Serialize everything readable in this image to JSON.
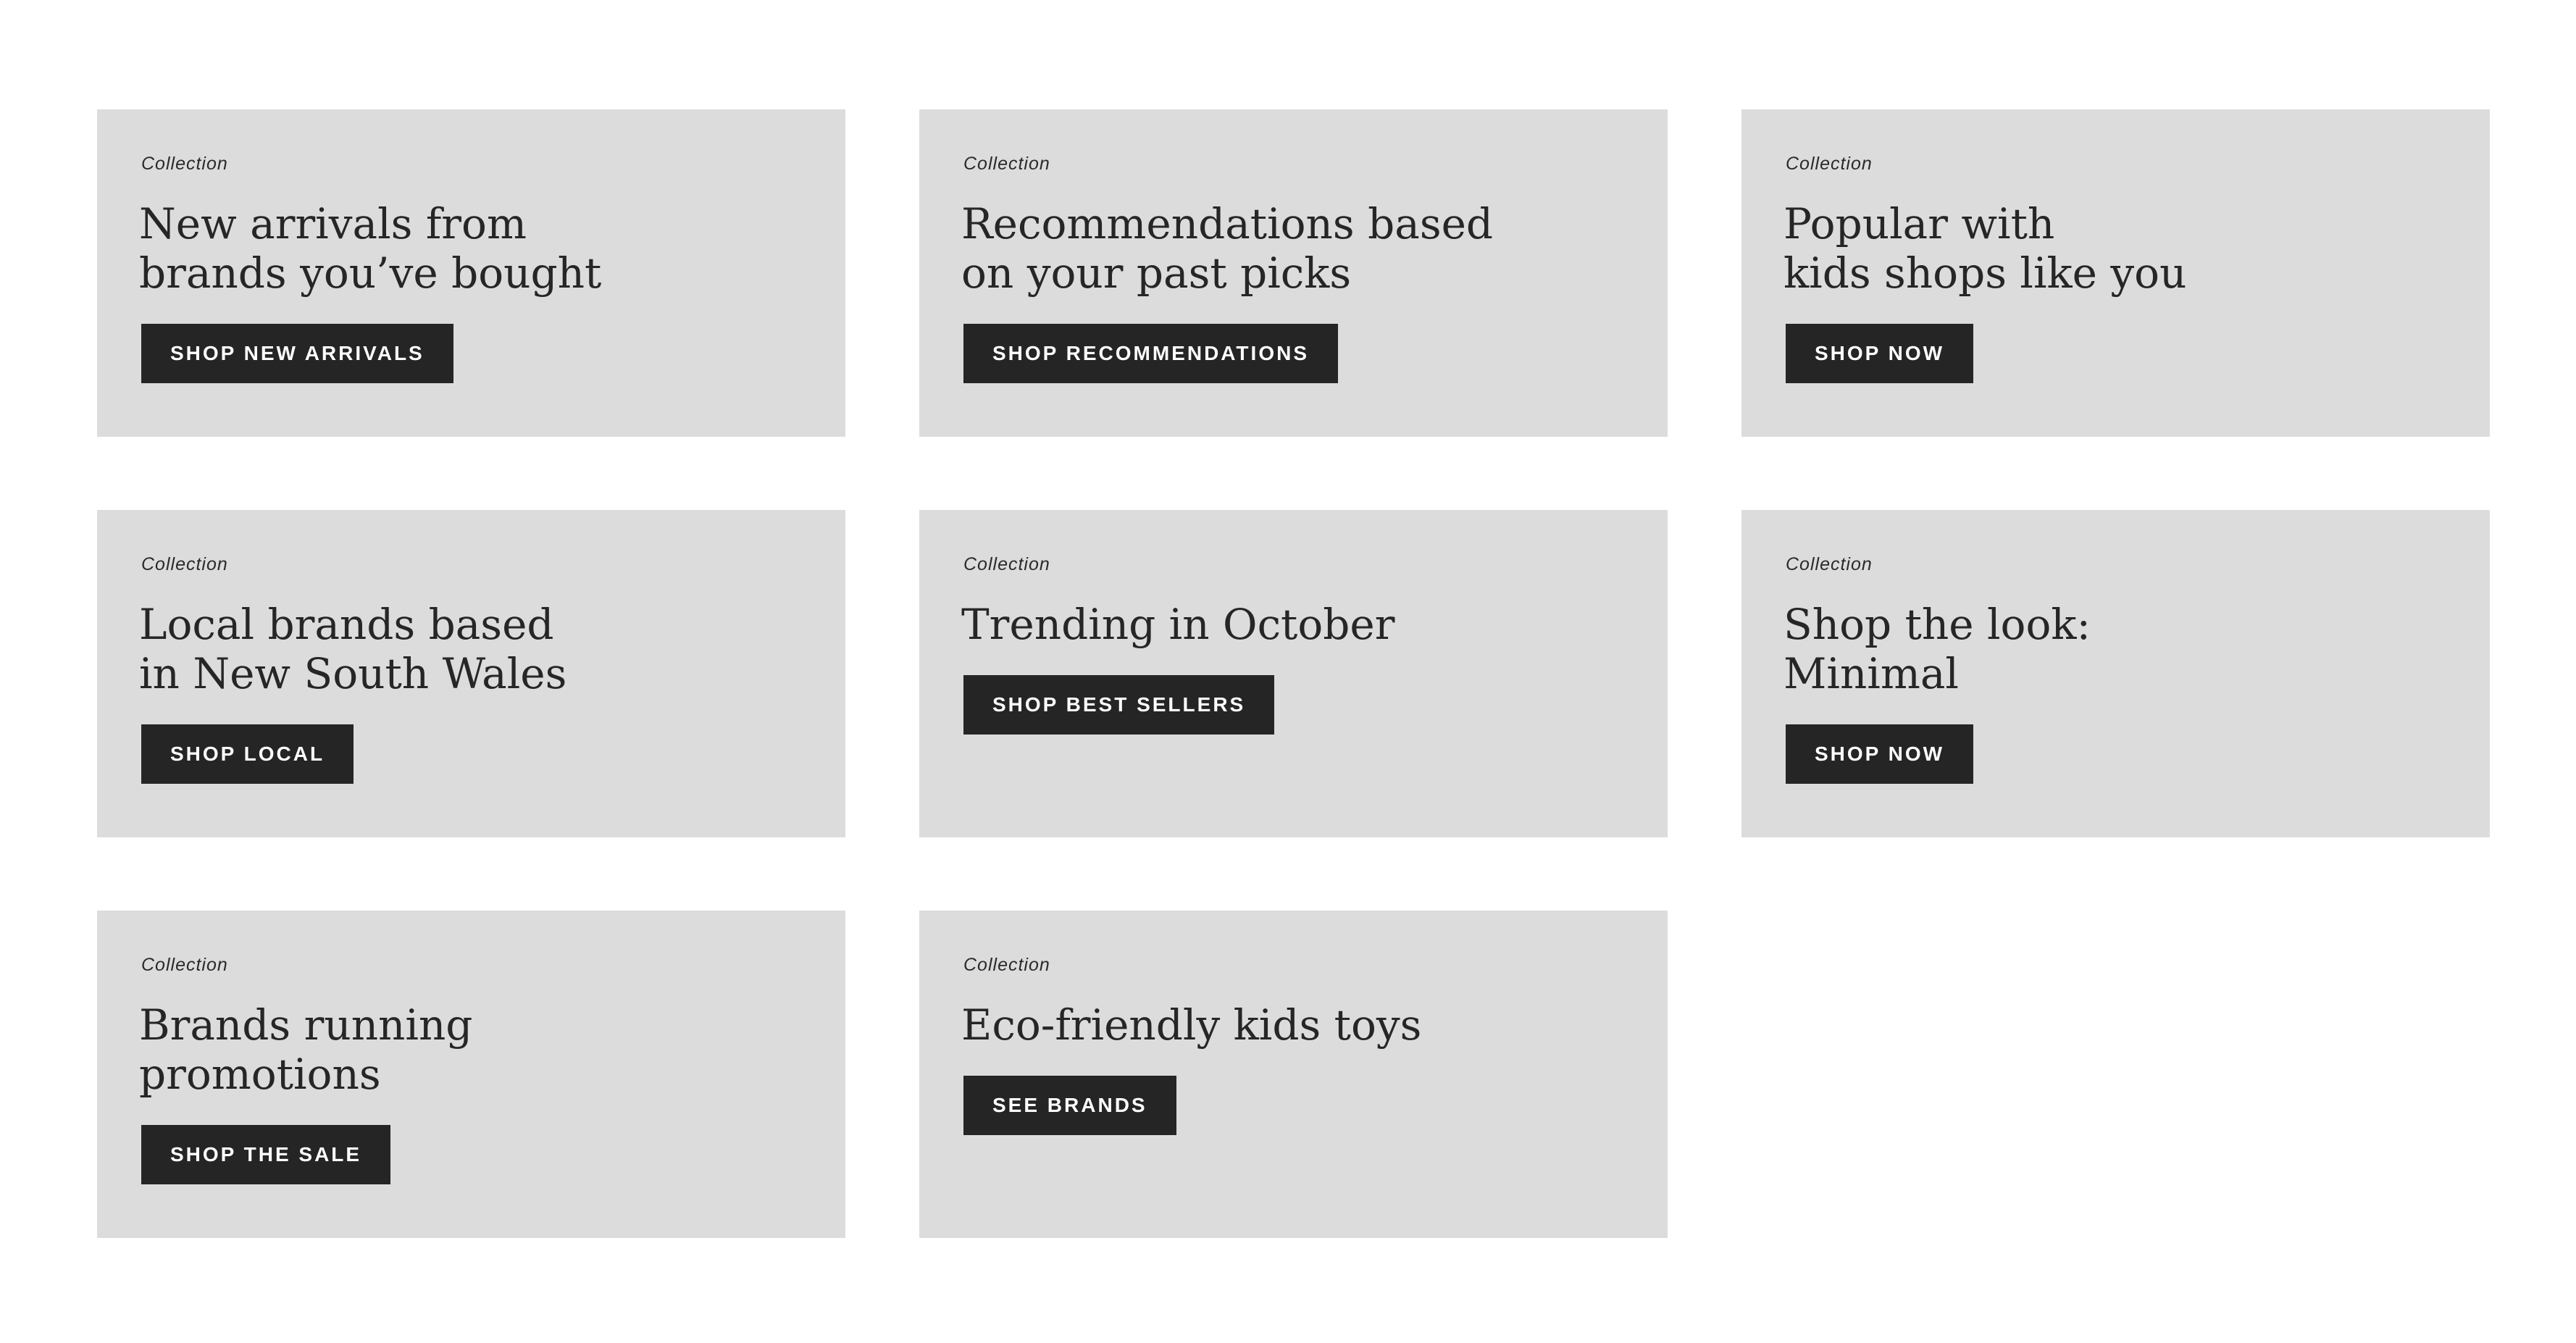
{
  "cards": [
    {
      "eyebrow": "Collection",
      "title": "New arrivals from\nbrands you’ve bought",
      "button": "SHOP NEW ARRIVALS"
    },
    {
      "eyebrow": "Collection",
      "title": "Recommendations based\non your past picks",
      "button": "SHOP RECOMMENDATIONS"
    },
    {
      "eyebrow": "Collection",
      "title": "Popular with\nkids shops like you",
      "button": "SHOP NOW"
    },
    {
      "eyebrow": "Collection",
      "title": "Local brands based\nin New South Wales",
      "button": "SHOP LOCAL"
    },
    {
      "eyebrow": "Collection",
      "title": "Trending in October",
      "button": "SHOP BEST SELLERS"
    },
    {
      "eyebrow": "Collection",
      "title": "Shop the look:\nMinimal",
      "button": "SHOP NOW"
    },
    {
      "eyebrow": "Collection",
      "title": "Brands running\npromotions",
      "button": "SHOP THE SALE"
    },
    {
      "eyebrow": "Collection",
      "title": "Eco-friendly kids toys",
      "button": "SEE BRANDS"
    }
  ],
  "colors": {
    "page_background": "#ffffff",
    "card_background": "#dcdcdc",
    "button_background": "#252525",
    "button_text": "#ffffff",
    "title_text": "#262626"
  }
}
